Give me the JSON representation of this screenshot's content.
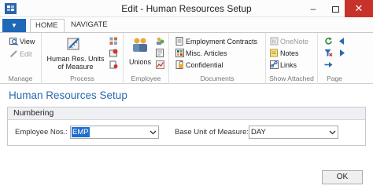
{
  "window": {
    "title": "Edit - Human Resources Setup",
    "minimize": "–",
    "close": "✕"
  },
  "tabs": [
    {
      "label": "HOME"
    },
    {
      "label": "NAVIGATE"
    }
  ],
  "app_menu": {
    "label": "▼"
  },
  "ribbon": {
    "manage": {
      "label": "Manage",
      "view": "View",
      "edit": "Edit"
    },
    "process": {
      "label": "Process",
      "units_line1": "Human Res. Units",
      "units_line2": "of Measure"
    },
    "employee": {
      "label": "Employee",
      "unions": "Unions"
    },
    "documents": {
      "label": "Documents",
      "employment_contracts": "Employment Contracts",
      "misc_articles": "Misc. Articles",
      "confidential": "Confidential"
    },
    "show_attached": {
      "label": "Show Attached",
      "onenote": "OneNote",
      "notes": "Notes",
      "links": "Links"
    },
    "page": {
      "label": "Page"
    }
  },
  "page_title": "Human Resources Setup",
  "numbering": {
    "header": "Numbering",
    "employee_nos_label": "Employee Nos.:",
    "employee_nos_value": "EMP",
    "base_uom_label": "Base Unit of Measure:",
    "base_uom_value": "DAY"
  },
  "ok_button": "OK",
  "colors": {
    "accent": "#1e68b7",
    "title": "#2a6aae",
    "close": "#c7322a"
  }
}
